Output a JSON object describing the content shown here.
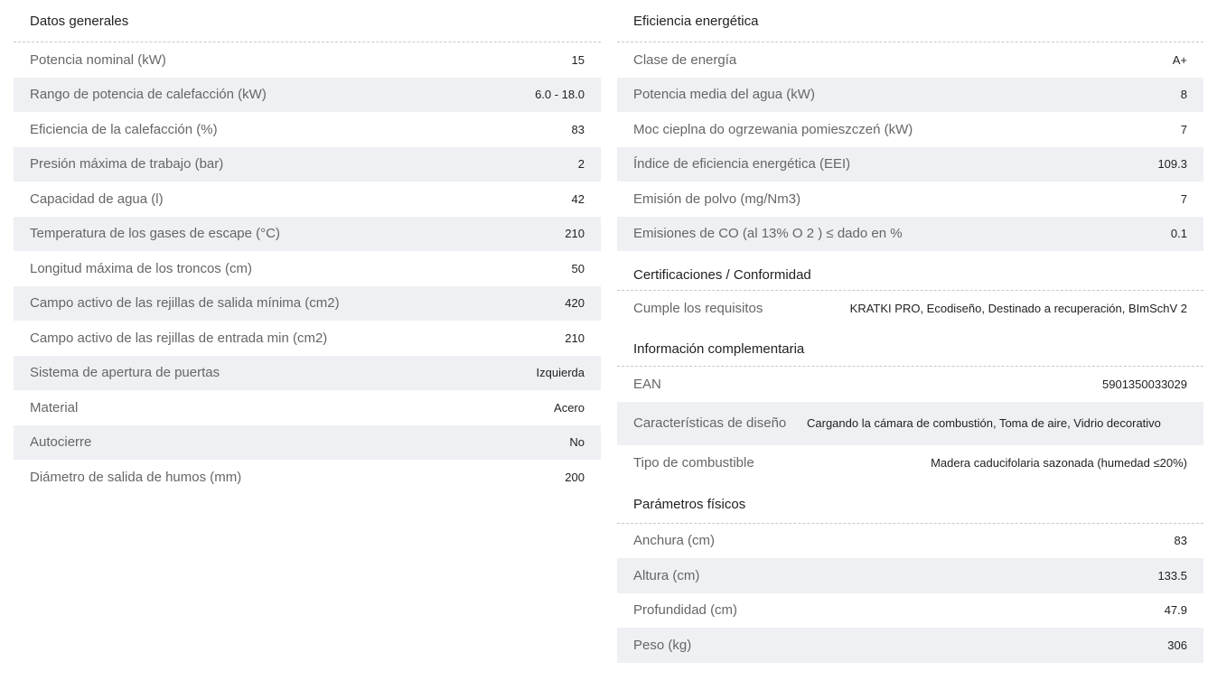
{
  "general": {
    "title": "Datos generales",
    "rows": [
      {
        "label": "Potencia nominal (kW)",
        "value": "15"
      },
      {
        "label": "Rango de potencia de calefacción (kW)",
        "value": "6.0 - 18.0"
      },
      {
        "label": "Eficiencia de la calefacción (%)",
        "value": "83"
      },
      {
        "label": "Presión máxima de trabajo (bar)",
        "value": "2"
      },
      {
        "label": "Capacidad de agua (l)",
        "value": "42"
      },
      {
        "label": "Temperatura de los gases de escape (°C)",
        "value": "210"
      },
      {
        "label": "Longitud máxima de los troncos (cm)",
        "value": "50"
      },
      {
        "label": "Campo activo de las rejillas de salida mínima (cm2)",
        "value": "420"
      },
      {
        "label": "Campo activo de las rejillas de entrada min (cm2)",
        "value": "210"
      },
      {
        "label": "Sistema de apertura de puertas",
        "value": "Izquierda"
      },
      {
        "label": "Material",
        "value": "Acero"
      },
      {
        "label": "Autocierre",
        "value": "No"
      },
      {
        "label": "Diámetro de salida de humos (mm)",
        "value": "200"
      }
    ]
  },
  "energy": {
    "title": "Eficiencia energética",
    "rows": [
      {
        "label": "Clase de energía",
        "value": "A+"
      },
      {
        "label": "Potencia media del agua (kW)",
        "value": "8"
      },
      {
        "label": "Moc cieplna do ogrzewania pomieszczeń (kW)",
        "value": "7"
      },
      {
        "label": "Índice de eficiencia energética (EEI)",
        "value": "109.3"
      },
      {
        "label": "Emisión de polvo (mg/Nm3)",
        "value": "7"
      },
      {
        "label": "Emisiones de CO (al 13% O 2 ) ≤ dado en %",
        "value": "0.1"
      }
    ]
  },
  "certifications": {
    "title": "Certificaciones / Conformidad",
    "rows": [
      {
        "label": "Cumple los requisitos",
        "value": "KRATKI PRO, Ecodiseño, Destinado a recuperación, BImSchV 2"
      }
    ]
  },
  "complementary": {
    "title": "Información complementaria",
    "rows": [
      {
        "label": "EAN",
        "value": "5901350033029"
      },
      {
        "label": "Características de diseño",
        "value": "Cargando la cámara de combustión, Toma de aire, Vidrio decorativo"
      },
      {
        "label": "Tipo de combustible",
        "value": "Madera caducifolaria sazonada (humedad ≤20%)"
      }
    ]
  },
  "physical": {
    "title": "Parámetros físicos",
    "rows": [
      {
        "label": "Anchura (cm)",
        "value": "83"
      },
      {
        "label": "Altura (cm)",
        "value": "133.5"
      },
      {
        "label": "Profundidad (cm)",
        "value": "47.9"
      },
      {
        "label": "Peso (kg)",
        "value": "306"
      }
    ]
  }
}
